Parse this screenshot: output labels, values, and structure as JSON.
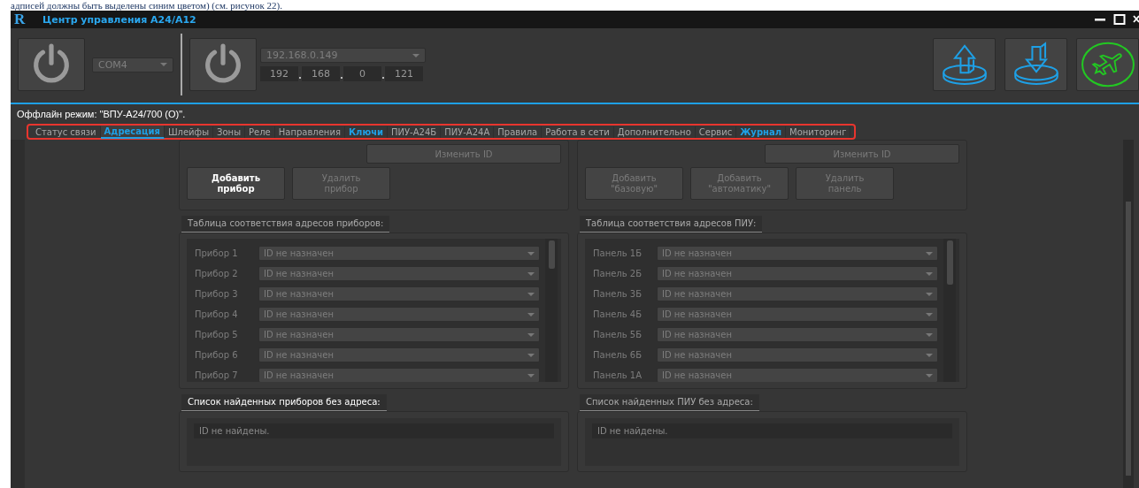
{
  "document_text": "адписей должны быть выделены синим цветом) (см. рисунок 22).",
  "window": {
    "title": "Центр управления А24/А12",
    "logo_text": "R"
  },
  "toolbar": {
    "com_port": "COM4",
    "ip_combo": "192.168.0.149",
    "ip_octets": [
      "192",
      "168",
      "0",
      "121"
    ]
  },
  "status_text": "Оффлайн режим: \"ВПУ-А24/700 (О)\".",
  "tabs": [
    {
      "label": "Статус связи",
      "selected": false,
      "highlighted": false
    },
    {
      "label": "Адресация",
      "selected": true,
      "highlighted": true
    },
    {
      "label": "Шлейфы",
      "selected": false,
      "highlighted": false
    },
    {
      "label": "Зоны",
      "selected": false,
      "highlighted": false
    },
    {
      "label": "Реле",
      "selected": false,
      "highlighted": false
    },
    {
      "label": "Направления",
      "selected": false,
      "highlighted": false
    },
    {
      "label": "Ключи",
      "selected": false,
      "highlighted": true
    },
    {
      "label": "ПИУ-А24Б",
      "selected": false,
      "highlighted": false
    },
    {
      "label": "ПИУ-А24А",
      "selected": false,
      "highlighted": false
    },
    {
      "label": "Правила",
      "selected": false,
      "highlighted": false
    },
    {
      "label": "Работа в сети",
      "selected": false,
      "highlighted": false
    },
    {
      "label": "Дополнительно",
      "selected": false,
      "highlighted": false
    },
    {
      "label": "Сервис",
      "selected": false,
      "highlighted": false
    },
    {
      "label": "Журнал",
      "selected": false,
      "highlighted": true
    },
    {
      "label": "Мониторинг",
      "selected": false,
      "highlighted": false
    }
  ],
  "columns": [
    {
      "change_id_button": {
        "label": "Изменить ID",
        "disabled": true
      },
      "buttons": [
        {
          "label": "Добавить\nприбор",
          "disabled": false
        },
        {
          "label": "Удалить\nприбор",
          "disabled": true
        }
      ],
      "table_header": {
        "label": "Таблица соответствия адресов приборов:",
        "disabled": true
      },
      "rows": [
        {
          "label": "Прибор 1",
          "value": "ID не назначен"
        },
        {
          "label": "Прибор 2",
          "value": "ID не назначен"
        },
        {
          "label": "Прибор 3",
          "value": "ID не назначен"
        },
        {
          "label": "Прибор 4",
          "value": "ID не назначен"
        },
        {
          "label": "Прибор 5",
          "value": "ID не назначен"
        },
        {
          "label": "Прибор 6",
          "value": "ID не назначен"
        },
        {
          "label": "Прибор 7",
          "value": "ID не назначен"
        }
      ],
      "found_header": {
        "label": "Список найденных приборов без адреса:",
        "disabled": false
      },
      "found_text": "ID не найдены."
    },
    {
      "change_id_button": {
        "label": "Изменить ID",
        "disabled": true
      },
      "buttons": [
        {
          "label": "Добавить\n\"базовую\"",
          "disabled": true
        },
        {
          "label": "Добавить\n\"автоматику\"",
          "disabled": true
        },
        {
          "label": "Удалить\nпанель",
          "disabled": true
        }
      ],
      "table_header": {
        "label": "Таблица соответствия адресов ПИУ:",
        "disabled": true
      },
      "rows": [
        {
          "label": "Панель 1Б",
          "value": "ID не назначен"
        },
        {
          "label": "Панель 2Б",
          "value": "ID не назначен"
        },
        {
          "label": "Панель 3Б",
          "value": "ID не назначен"
        },
        {
          "label": "Панель 4Б",
          "value": "ID не назначен"
        },
        {
          "label": "Панель 5Б",
          "value": "ID не назначен"
        },
        {
          "label": "Панель 6Б",
          "value": "ID не назначен"
        },
        {
          "label": "Панель 1А",
          "value": "ID не назначен"
        }
      ],
      "found_header": {
        "label": "Список найденных ПИУ без адреса:",
        "disabled": true
      },
      "found_text": "ID не найдены."
    }
  ]
}
